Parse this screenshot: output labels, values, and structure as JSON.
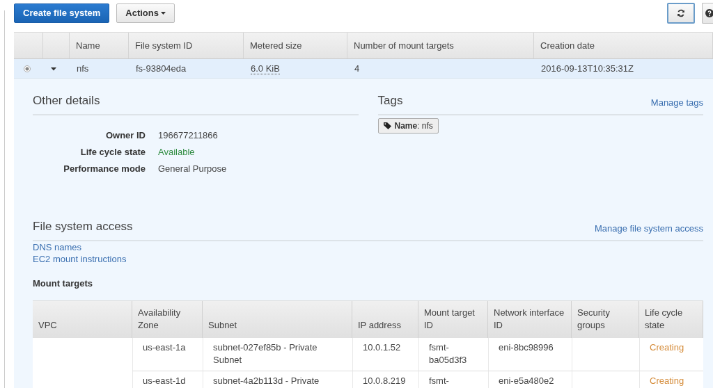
{
  "toolbar": {
    "create_button": "Create file system",
    "actions_button": "Actions"
  },
  "file_systems": {
    "columns": [
      "Name",
      "File system ID",
      "Metered size",
      "Number of mount targets",
      "Creation date"
    ],
    "rows": [
      {
        "selected": true,
        "expanded": true,
        "name": "nfs",
        "id": "fs-93804eda",
        "metered_size": "6.0 KiB",
        "mount_targets": "4",
        "creation_date": "2016-09-13T10:35:31Z"
      }
    ]
  },
  "other_details": {
    "title": "Other details",
    "fields": [
      {
        "label": "Owner ID",
        "value": "196677211866"
      },
      {
        "label": "Life cycle state",
        "value": "Available",
        "color": "#2e8b40"
      },
      {
        "label": "Performance mode",
        "value": "General Purpose"
      }
    ]
  },
  "tags": {
    "title": "Tags",
    "manage_link": "Manage tags",
    "items": [
      "**Name**: nfs"
    ]
  },
  "access": {
    "title": "File system access",
    "manage_link": "Manage file system access",
    "links": [
      "DNS names",
      "EC2 mount instructions"
    ]
  },
  "mount_targets": {
    "title": "Mount targets",
    "columns": [
      "VPC",
      "Availability Zone",
      "Subnet",
      "IP address",
      "Mount target ID",
      "Network interface ID",
      "Security groups",
      "Life cycle state"
    ],
    "rows": [
      {
        "zone": "us-east-1a",
        "subnet": "subnet-027ef85b - Private Subnet",
        "ip": "10.0.1.52",
        "target_id": "fsmt-ba05d3f3",
        "interface_id": "eni-8bc98996",
        "state": "Creating",
        "color": "#d58c3a"
      },
      {
        "zone": "us-east-1d",
        "subnet": "subnet-4a2b113d - Private",
        "ip": "10.0.8.219",
        "target_id": "fsmt-",
        "interface_id": "eni-e5a480e2",
        "state": "Creating",
        "color": "#d58c3a"
      }
    ]
  }
}
